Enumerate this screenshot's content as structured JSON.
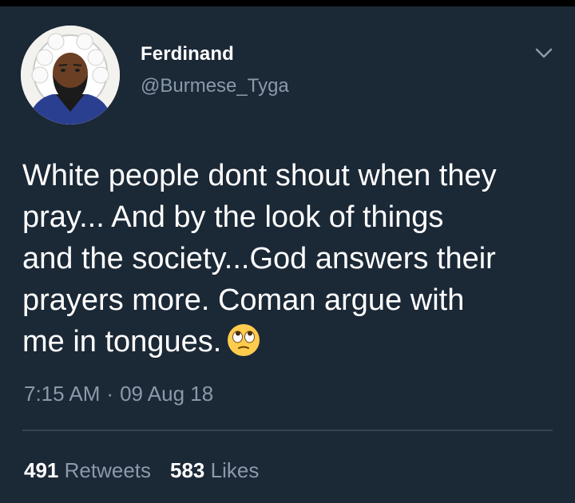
{
  "tweet": {
    "author": {
      "name": "Ferdinand",
      "handle": "@Burmese_Tyga",
      "avatar_icon": "profile-avatar"
    },
    "menu_icon": "chevron-down-icon",
    "text_lines": [
      "White people dont shout when they",
      "pray... And by the look of things",
      "and the society...God answers their",
      "prayers more. Coman argue with",
      "me in tongues."
    ],
    "emoji": "face-with-rolling-eyes-emoji",
    "time": "7:15 AM",
    "separator": "·",
    "date": "09 Aug 18",
    "retweets": {
      "count": "491",
      "label": "Retweets"
    },
    "likes": {
      "count": "583",
      "label": "Likes"
    },
    "colors": {
      "background": "#1b2836",
      "text": "#ffffff",
      "secondary": "#8a9aab",
      "divider": "#37444f"
    }
  }
}
